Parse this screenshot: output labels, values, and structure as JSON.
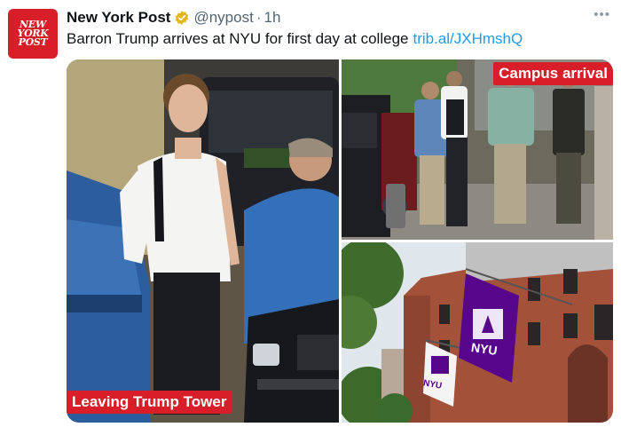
{
  "tweet": {
    "avatar_lines": [
      "NEW",
      "YORK",
      "POST"
    ],
    "author": "New York Post",
    "handle": "@nypost",
    "separator": "·",
    "time": "1h",
    "more_icon": "more-horizontal-icon",
    "text": "Barron Trump arrives at NYU for first day at college",
    "link": "trib.al/JXHmshQ"
  },
  "media": {
    "captions": {
      "main": "Leaving Trump Tower",
      "campus": "Campus arrival"
    },
    "flag_label": "NYU"
  },
  "colors": {
    "brand_red": "#d81e28",
    "link_blue": "#1d9bf0",
    "verified_gold": "#e2b719",
    "nyu_purple": "#57068c"
  }
}
